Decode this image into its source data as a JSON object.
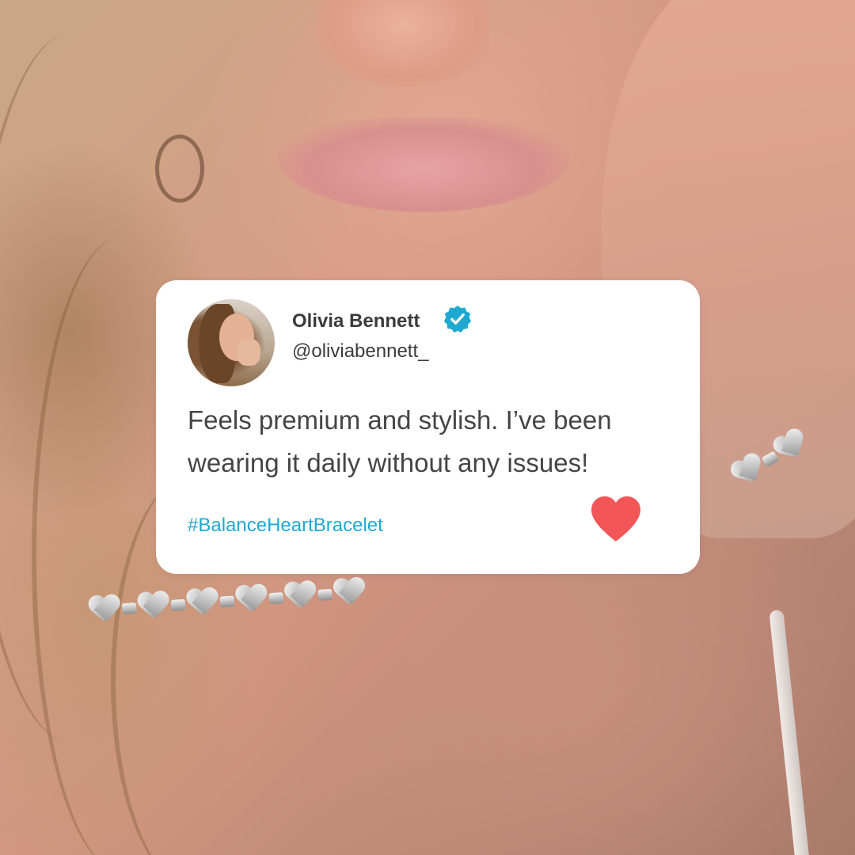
{
  "user": {
    "name": "Olivia Bennett",
    "handle": "@oliviabennett_"
  },
  "post": {
    "text": "Feels premium and stylish. I’ve been wearing it daily without any issues!",
    "hashtag": "#BalanceHeartBracelet"
  },
  "icons": {
    "verified": "verified-badge-icon",
    "like": "heart-icon"
  },
  "colors": {
    "card_background": "#ffffff",
    "verified_badge": "#1fa9d0",
    "hashtag": "#1fa9d0",
    "heart": "#f25656",
    "text": "#454545"
  }
}
